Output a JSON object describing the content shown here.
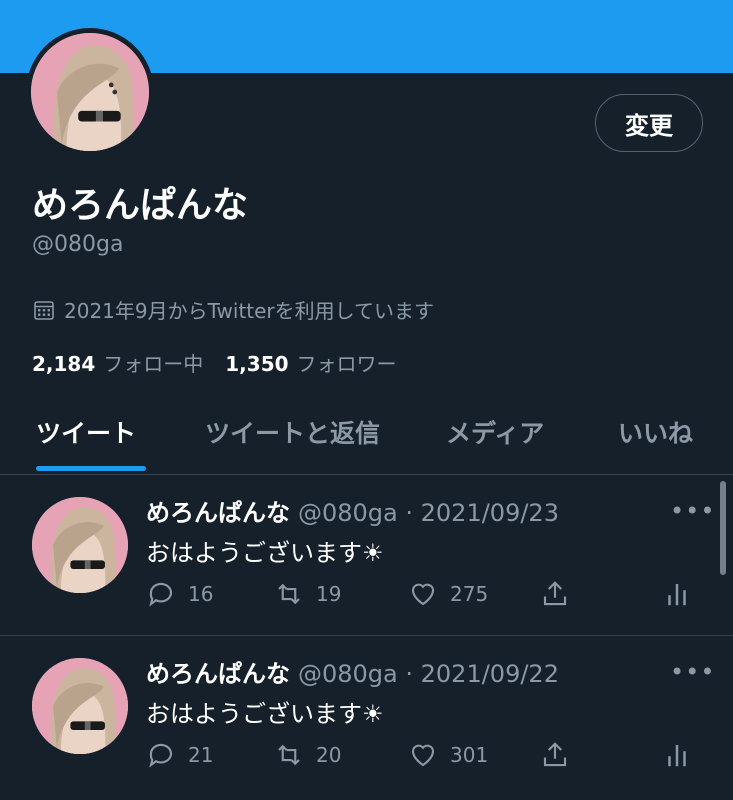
{
  "profile": {
    "name": "めろんぱんな",
    "handle": "@080ga",
    "joined": "2021年9月からTwitterを利用しています",
    "edit_label": "変更",
    "following_count": "2,184",
    "following_label": "フォロー中",
    "followers_count": "1,350",
    "followers_label": "フォロワー"
  },
  "tabs": [
    {
      "label": "ツイート",
      "active": true
    },
    {
      "label": "ツイートと返信",
      "active": false
    },
    {
      "label": "メディア",
      "active": false
    },
    {
      "label": "いいね",
      "active": false
    }
  ],
  "tweets": [
    {
      "name": "めろんぱんな",
      "meta": "@080ga · 2021/09/23",
      "text": "おはようございます☀",
      "more": "•••",
      "replies": "16",
      "retweets": "19",
      "likes": "275"
    },
    {
      "name": "めろんぱんな",
      "meta": "@080ga · 2021/09/22",
      "text": "おはようございます☀",
      "more": "•••",
      "replies": "21",
      "retweets": "20",
      "likes": "301"
    }
  ],
  "colors": {
    "background": "#15202b",
    "accent": "#1d9bf0",
    "secondary_text": "#8b98a5",
    "divider": "#38444d"
  },
  "icons": {
    "calendar": "calendar-icon",
    "reply": "reply-icon",
    "retweet": "retweet-icon",
    "like": "heart-icon",
    "share": "share-icon",
    "analytics": "analytics-icon",
    "more": "more-icon"
  }
}
